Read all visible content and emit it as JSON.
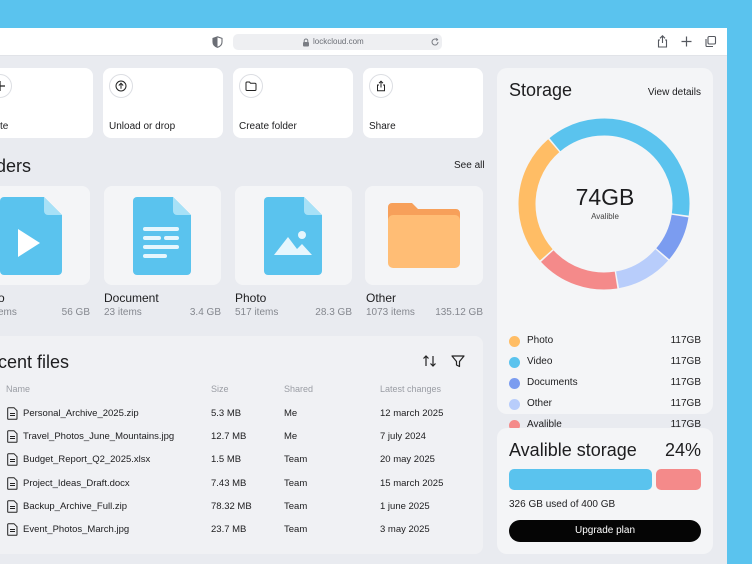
{
  "browser": {
    "url": "lockcloud.com"
  },
  "actions": [
    {
      "label": "te"
    },
    {
      "label": "Unload or drop"
    },
    {
      "label": "Create folder"
    },
    {
      "label": "Share"
    }
  ],
  "folders_section": {
    "title": "ders",
    "see_all": "See all",
    "items": [
      {
        "name": "o",
        "count": "ems",
        "size": "56 GB",
        "icon": "video-icon",
        "color": "#5ac3ee"
      },
      {
        "name": "Document",
        "count": "23 items",
        "size": "3.4 GB",
        "icon": "document-icon",
        "color": "#5ac3ee"
      },
      {
        "name": "Photo",
        "count": "517 items",
        "size": "28.3 GB",
        "icon": "photo-icon",
        "color": "#5ac3ee"
      },
      {
        "name": "Other",
        "count": "1073 items",
        "size": "135.12 GB",
        "icon": "folder-icon",
        "color": "#ffb56b"
      }
    ]
  },
  "recent_files": {
    "title": "ecent files",
    "columns": {
      "name": "Name",
      "size": "Size",
      "shared": "Shared",
      "changes": "Latest changes"
    },
    "rows": [
      {
        "name": "Personal_Archive_2025.zip",
        "size": "5.3 MB",
        "shared": "Me",
        "changed": "12 march 2025"
      },
      {
        "name": "Travel_Photos_June_Mountains.jpg",
        "size": "12.7 MB",
        "shared": "Me",
        "changed": "7 july 2024"
      },
      {
        "name": "Budget_Report_Q2_2025.xlsx",
        "size": "1.5 MB",
        "shared": "Team",
        "changed": "20 may 2025"
      },
      {
        "name": "Project_Ideas_Draft.docx",
        "size": "7.43 MB",
        "shared": "Team",
        "changed": "15 march 2025"
      },
      {
        "name": "Backup_Archive_Full.zip",
        "size": "78.32 MB",
        "shared": "Team",
        "changed": "1 june 2025"
      },
      {
        "name": "Event_Photos_March.jpg",
        "size": "23.7 MB",
        "shared": "Team",
        "changed": "3 may 2025"
      }
    ]
  },
  "storage": {
    "title": "Storage",
    "view_details": "View details",
    "center_value": "74GB",
    "center_label": "Avalible",
    "segments": [
      {
        "label": "Photo",
        "value": "117GB",
        "color": "#ffbd65",
        "share": 0.255
      },
      {
        "label": "Video",
        "value": "117GB",
        "color": "#5ac3ee",
        "share": 0.385
      },
      {
        "label": "Documents",
        "value": "117GB",
        "color": "#7b9cf0",
        "share": 0.09
      },
      {
        "label": "Other",
        "value": "117GB",
        "color": "#b8cdfb",
        "share": 0.11
      },
      {
        "label": "Avalible",
        "value": "117GB",
        "color": "#f48a8a",
        "share": 0.16
      }
    ]
  },
  "available": {
    "title": "Avalible storage",
    "percent": "24%",
    "used_fraction": 0.76,
    "usage_text": "326 GB used of 400 GB",
    "upgrade_label": "Upgrade plan"
  }
}
